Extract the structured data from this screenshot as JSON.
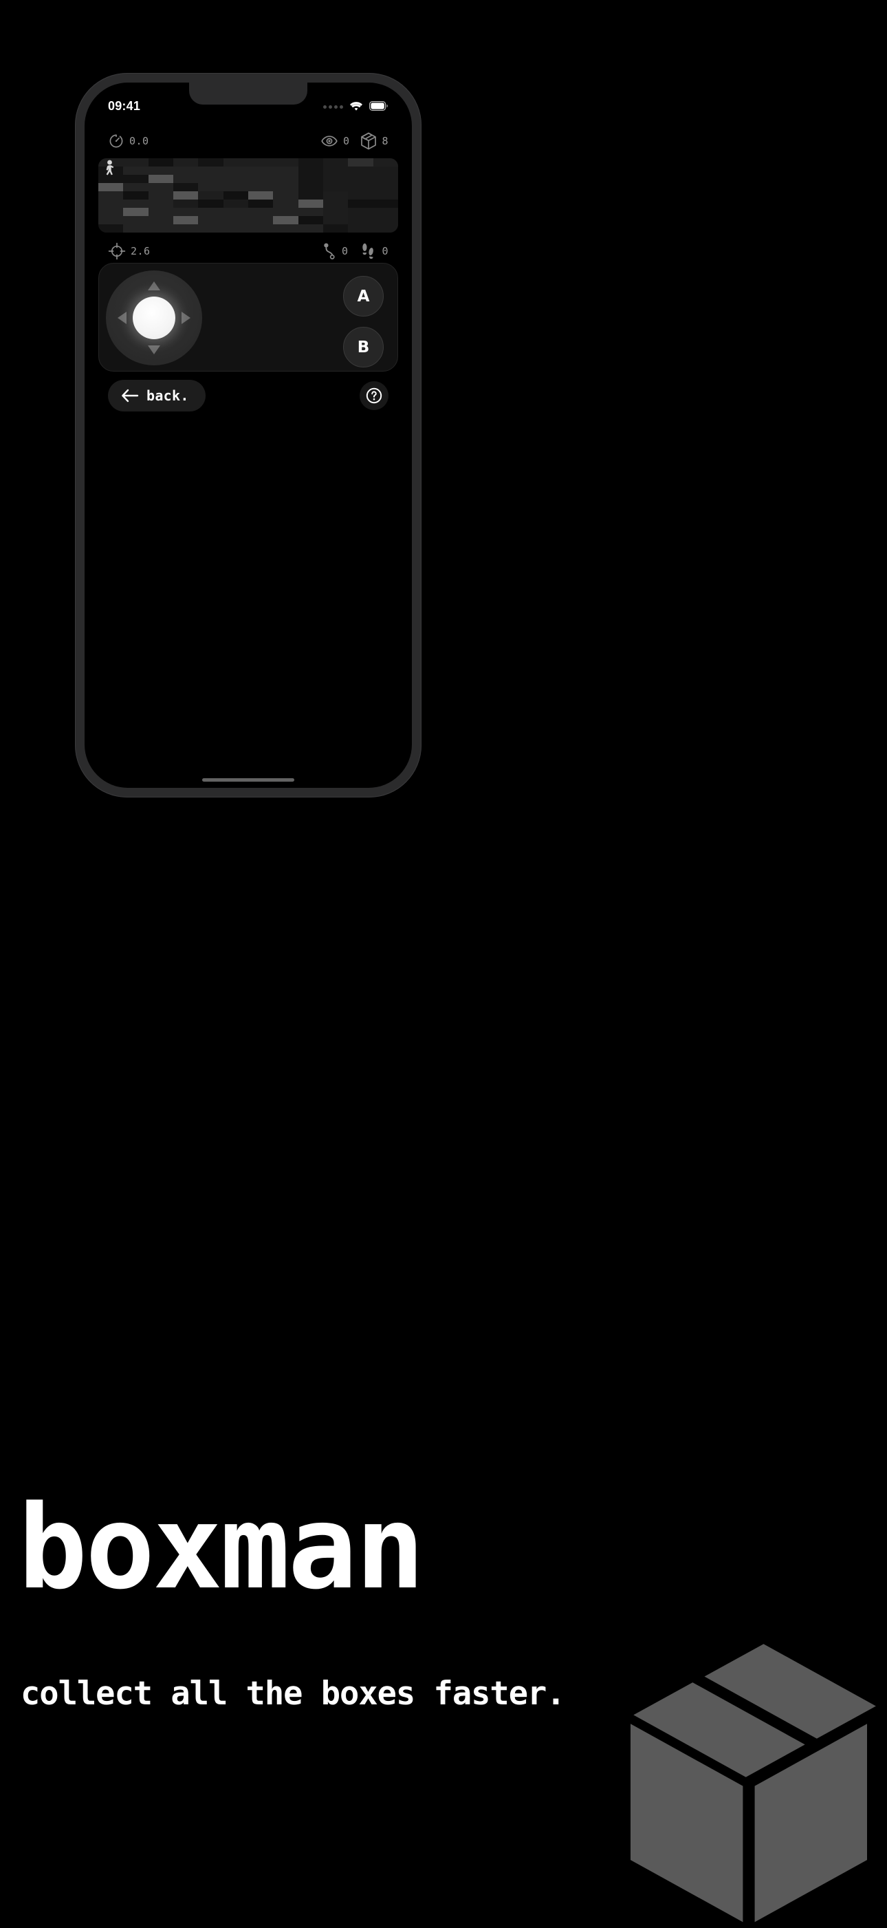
{
  "status_bar": {
    "time": "09:41",
    "signal_icon": "signal-dots-icon",
    "wifi_icon": "wifi-icon",
    "battery_icon": "battery-full-icon"
  },
  "hud_top": {
    "timer": {
      "icon": "stopwatch-icon",
      "value": "0.0"
    },
    "vision": {
      "icon": "eye-icon",
      "value": "0"
    },
    "boxes": {
      "icon": "box-icon",
      "value": "8"
    }
  },
  "hud_bottom": {
    "target": {
      "icon": "crosshair-icon",
      "value": "2.6"
    },
    "path": {
      "icon": "route-icon",
      "value": "0"
    },
    "steps": {
      "icon": "footsteps-icon",
      "value": "0"
    }
  },
  "game_board": {
    "player_icon": "walking-person-icon",
    "grid_rows": 9,
    "grid_cols": 12,
    "tile_shades": [
      [
        "#1e1e1e",
        "#1e1e1e",
        "#111111",
        "#1e1e1e",
        "#141414",
        "#1e1e1e",
        "#1e1e1e",
        "#1e1e1e",
        "#151515",
        "#1b1b1b",
        "#2f2f2f",
        "#1e1e1e"
      ],
      [
        "#141414",
        "#232323",
        "#232323",
        "#232323",
        "#232323",
        "#232323",
        "#232323",
        "#232323",
        "#151515",
        "#1b1b1b",
        "#1b1b1b",
        "#1b1b1b"
      ],
      [
        "#141414",
        "#141414",
        "#565656",
        "#232323",
        "#232323",
        "#232323",
        "#232323",
        "#232323",
        "#151515",
        "#1b1b1b",
        "#1b1b1b",
        "#1b1b1b"
      ],
      [
        "#565656",
        "#232323",
        "#232323",
        "#141414",
        "#232323",
        "#232323",
        "#232323",
        "#232323",
        "#151515",
        "#1b1b1b",
        "#1b1b1b",
        "#1b1b1b"
      ],
      [
        "#232323",
        "#111111",
        "#232323",
        "#565656",
        "#1e1e1e",
        "#111111",
        "#565656",
        "#232323",
        "#151515",
        "#1d1d1d",
        "#1b1b1b",
        "#1b1b1b"
      ],
      [
        "#232323",
        "#232323",
        "#232323",
        "#1b1b1b",
        "#111111",
        "#1b1b1b",
        "#111111",
        "#232323",
        "#565656",
        "#1d1d1d",
        "#111111",
        "#111111"
      ],
      [
        "#232323",
        "#565656",
        "#232323",
        "#232323",
        "#232323",
        "#232323",
        "#232323",
        "#232323",
        "#232323",
        "#1d1d1d",
        "#1b1b1b",
        "#1b1b1b"
      ],
      [
        "#232323",
        "#232323",
        "#232323",
        "#565656",
        "#232323",
        "#232323",
        "#232323",
        "#565656",
        "#111111",
        "#1d1d1d",
        "#1b1b1b",
        "#1b1b1b"
      ],
      [
        "#141414",
        "#232323",
        "#232323",
        "#232323",
        "#232323",
        "#232323",
        "#232323",
        "#232323",
        "#232323",
        "#141414",
        "#1b1b1b",
        "#1b1b1b"
      ]
    ]
  },
  "controller": {
    "dpad": {
      "up_label": "up",
      "down_label": "down",
      "left_label": "left",
      "right_label": "right"
    },
    "button_a": "A",
    "button_b": "B"
  },
  "bottom_nav": {
    "back_label": "back.",
    "back_icon": "arrow-left-icon",
    "help_icon": "question-mark-circle-icon"
  },
  "marketing": {
    "title": "boxman",
    "tagline": "collect all the boxes faster.",
    "box_graphic_icon": "isometric-box-icon"
  },
  "colors": {
    "background": "#000000",
    "frame": "#2b2b2c",
    "panel": "#121212",
    "accent_white": "#ffffff",
    "muted": "#8a8a8a",
    "box_gray": "#5a5a5a"
  }
}
